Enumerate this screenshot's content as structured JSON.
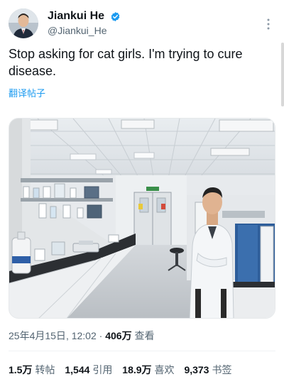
{
  "author": {
    "name": "Jiankui He",
    "handle": "@Jiankui_He",
    "verified": true
  },
  "tweet": {
    "text": "Stop asking for cat girls. I'm trying to cure disease.",
    "translate_label": "翻译帖子"
  },
  "photo": {
    "sign_top": "EXIT"
  },
  "meta": {
    "date": "25年4月15日",
    "time": "12:02",
    "separator": "·",
    "views": "406万",
    "views_label": "查看"
  },
  "stats": [
    {
      "num": "1.5万",
      "label": "转帖"
    },
    {
      "num": "1,544",
      "label": "引用"
    },
    {
      "num": "18.9万",
      "label": "喜欢"
    },
    {
      "num": "9,373",
      "label": "书签"
    }
  ],
  "colors": {
    "accent": "#1d9bf0",
    "text": "#0f1419",
    "muted": "#536471"
  },
  "icons": {
    "verified": "verified-badge-icon",
    "more": "more-dots-icon"
  }
}
